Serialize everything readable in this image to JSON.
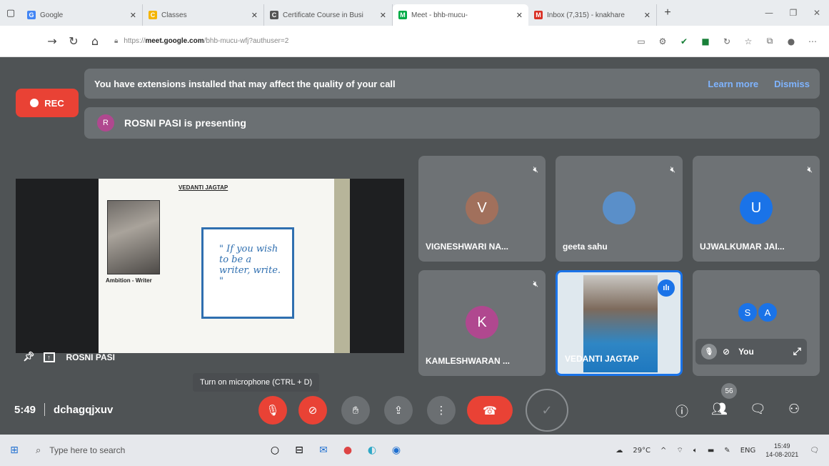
{
  "browser": {
    "tabs": [
      {
        "label": "Google",
        "fav": "G",
        "color": "#4285f4"
      },
      {
        "label": "Classes",
        "fav": "C",
        "color": "#f4b400"
      },
      {
        "label": "Certificate Course in Busi",
        "fav": "C",
        "color": "#555555"
      },
      {
        "label": "Meet - bhb-mucu-",
        "fav": "M",
        "color": "#00ac47"
      },
      {
        "label": "Inbox (7,315) - knakhare",
        "fav": "M",
        "color": "#d93025"
      }
    ],
    "url_prefix": "https://",
    "url_host": "meet.google.com",
    "url_path": "/bhb-mucu-wfj?authuser=2"
  },
  "meet": {
    "notice_text": "You have extensions installed that may affect the quality of your call",
    "learn_more": "Learn more",
    "dismiss": "Dismiss",
    "rec_label": "REC",
    "presenting_initial": "R",
    "presenting_text": "ROSNI PASI is presenting",
    "slide": {
      "title": "VEDANTI JAGTAP",
      "caption": "Ambition - Writer",
      "quote": "\" If you wish to be a writer, write. \""
    },
    "presenter_name": "ROSNI PASI",
    "participants": [
      {
        "name": "VIGNESHWARI NA...",
        "initial": "V",
        "color": "#a1705c"
      },
      {
        "name": "geeta sahu",
        "initial": "",
        "color": "#5a8fc9"
      },
      {
        "name": "UJWALKUMAR JAI...",
        "initial": "U",
        "color": "#1a73e8"
      },
      {
        "name": "KAMLESHWARAN ...",
        "initial": "K",
        "color": "#b0488f"
      },
      {
        "name": "VEDANTI JAGTAP",
        "initial": "",
        "color": ""
      }
    ],
    "self": {
      "initials": [
        "S",
        "A"
      ],
      "label": "You"
    },
    "tooltip": "Turn on microphone (CTRL + D)",
    "time": "5:49",
    "meeting_code": "dchagqjxuv",
    "participant_count": "56"
  },
  "taskbar": {
    "search_placeholder": "Type here to search",
    "temperature": "29°C",
    "language": "ENG",
    "time": "15:49",
    "date": "14-08-2021"
  }
}
